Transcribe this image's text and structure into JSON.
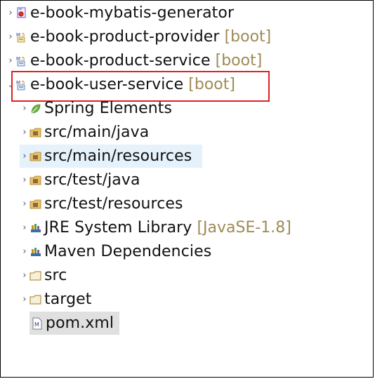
{
  "tree": {
    "projects": [
      {
        "label": "e-book-mybatis-generator",
        "suffix": "",
        "icon": "java-project-icon"
      },
      {
        "label": "e-book-product-provider",
        "suffix": "[boot]",
        "icon": "maven-spring-project-icon"
      },
      {
        "label": "e-book-product-service",
        "suffix": "[boot]",
        "icon": "maven-spring-project-icon"
      },
      {
        "label": "e-book-user-service",
        "suffix": "[boot]",
        "icon": "maven-spring-project-icon"
      }
    ],
    "children": [
      {
        "label": "Spring Elements",
        "suffix": "",
        "icon": "spring-leaf-icon"
      },
      {
        "label": "src/main/java",
        "suffix": "",
        "icon": "source-folder-icon"
      },
      {
        "label": "src/main/resources",
        "suffix": "",
        "icon": "source-folder-icon"
      },
      {
        "label": "src/test/java",
        "suffix": "",
        "icon": "source-folder-icon"
      },
      {
        "label": "src/test/resources",
        "suffix": "",
        "icon": "source-folder-icon"
      },
      {
        "label": "JRE System Library",
        "suffix": "[JavaSE-1.8]",
        "icon": "library-icon"
      },
      {
        "label": "Maven Dependencies",
        "suffix": "",
        "icon": "library-icon"
      },
      {
        "label": "src",
        "suffix": "",
        "icon": "folder-icon"
      },
      {
        "label": "target",
        "suffix": "",
        "icon": "folder-icon"
      },
      {
        "label": "pom.xml",
        "suffix": "",
        "icon": "maven-pom-file-icon"
      }
    ]
  },
  "colors": {
    "decoration_suffix": "#a08a55",
    "highlight_box": "#e02020",
    "selection_blue": "#e5f1fb",
    "selection_grey": "#e0e0e0"
  }
}
